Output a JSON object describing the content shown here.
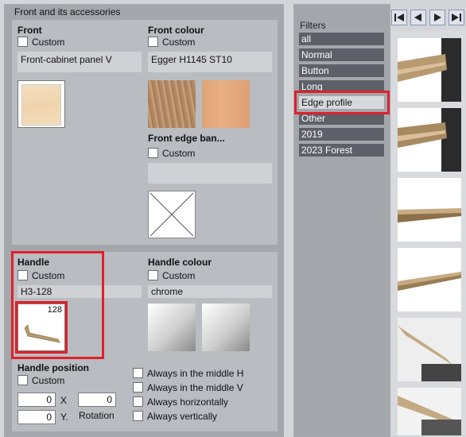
{
  "group": {
    "title": "Front and its accessories"
  },
  "front": {
    "title": "Front",
    "custom_label": "Custom",
    "value": "Front-cabinet panel V"
  },
  "front_colour": {
    "title": "Front colour",
    "custom_label": "Custom",
    "value": "Egger H1145 ST10"
  },
  "front_edge": {
    "title": "Front edge ban...",
    "custom_label": "Custom",
    "value": ""
  },
  "handle": {
    "title": "Handle",
    "custom_label": "Custom",
    "value": "H3-128",
    "thumb_badge": "128"
  },
  "handle_colour": {
    "title": "Handle colour",
    "custom_label": "Custom",
    "value": "chrome"
  },
  "handle_position": {
    "title": "Handle position",
    "custom_label": "Custom",
    "x_value": "0",
    "x_label": "X",
    "y_value": "0",
    "y_label": "Y.",
    "rotation_value": "0",
    "rotation_label": "Rotation",
    "options": [
      "Always in the middle H",
      "Always in the middle V",
      "Always horizontally",
      "Always vertically"
    ]
  },
  "filters": {
    "label": "Filters",
    "items": [
      "all",
      "Normal",
      "Button",
      "Long",
      "Edge profile",
      "Other",
      "2019",
      "2023 Forest"
    ],
    "selected": "Edge profile"
  },
  "nav": [
    "first-icon",
    "prev-icon",
    "next-icon",
    "last-icon"
  ],
  "colors": {
    "highlight": "#e0202a",
    "filter_bg": "#5d6068"
  }
}
